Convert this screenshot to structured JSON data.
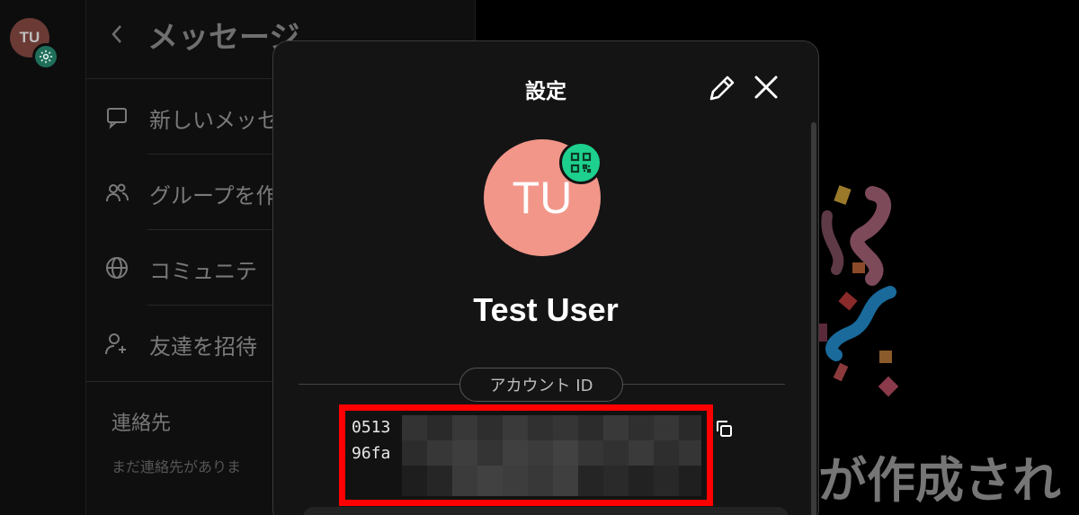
{
  "rail": {
    "avatar_initials": "TU"
  },
  "panel": {
    "title": "メッセージ",
    "menu": [
      {
        "label": "新しいメッセ",
        "icon": "chat-bubble-icon"
      },
      {
        "label": "グループを作",
        "icon": "group-icon"
      },
      {
        "label": "コミュニテ",
        "icon": "globe-icon"
      },
      {
        "label": "友達を招待",
        "icon": "add-user-icon"
      }
    ],
    "contacts_title": "連絡先",
    "contacts_empty": "まだ連絡先がありま"
  },
  "background": {
    "heading": "が作成され"
  },
  "modal": {
    "title": "設定",
    "avatar_initials": "TU",
    "user_name": "Test User",
    "account_id_label": "アカウント ID",
    "account_id_line1": "0513",
    "account_id_line2": "96fa"
  },
  "colors": {
    "accent_green": "#1ed08d",
    "avatar_salmon": "#f2968a",
    "highlight_red": "#ff0000"
  }
}
